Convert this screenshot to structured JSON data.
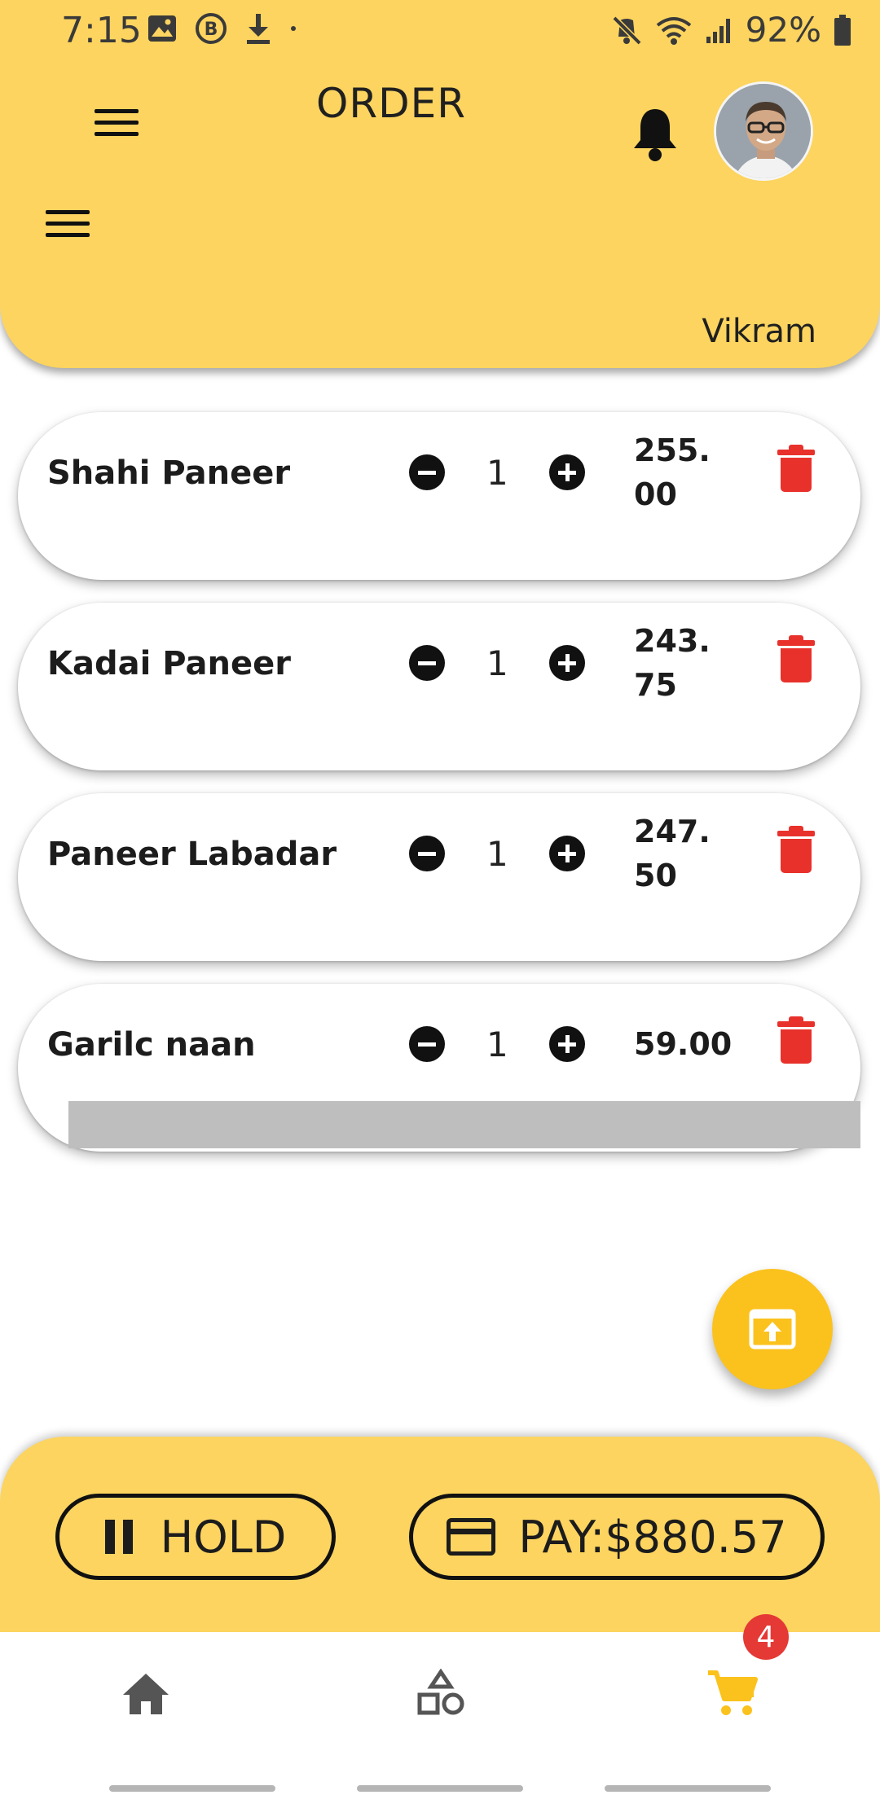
{
  "status_bar": {
    "time": "7:15",
    "battery_pct": "92%",
    "left_icons": [
      "image-icon",
      "b-icon",
      "download-icon",
      "dot-icon"
    ],
    "right_icons": [
      "mute-icon",
      "wifi-icon",
      "signal-icon",
      "battery-icon"
    ]
  },
  "header": {
    "title": "ORDER",
    "username": "Vikram",
    "bg_color": "#fcd45f"
  },
  "order_items": [
    {
      "name": "Shahi Paneer",
      "qty": "1",
      "price": "255.00"
    },
    {
      "name": "Kadai Paneer",
      "qty": "1",
      "price": "243.75"
    },
    {
      "name": "Paneer Labadar",
      "qty": "1",
      "price": "247.50"
    },
    {
      "name": "Garilc naan",
      "qty": "1",
      "price": "59.00"
    }
  ],
  "actions": {
    "hold_label": "HOLD",
    "pay_label": "PAY:$880.57"
  },
  "bottom_nav": {
    "items": [
      "home-icon",
      "shapes-icon",
      "cart-icon"
    ],
    "active": "cart-icon",
    "active_color": "#fbc21d",
    "cart_badge": "4"
  },
  "colors": {
    "accent": "#fcd45f",
    "fab": "#fbc21d",
    "delete": "#e8312b",
    "badge": "#e53935"
  }
}
